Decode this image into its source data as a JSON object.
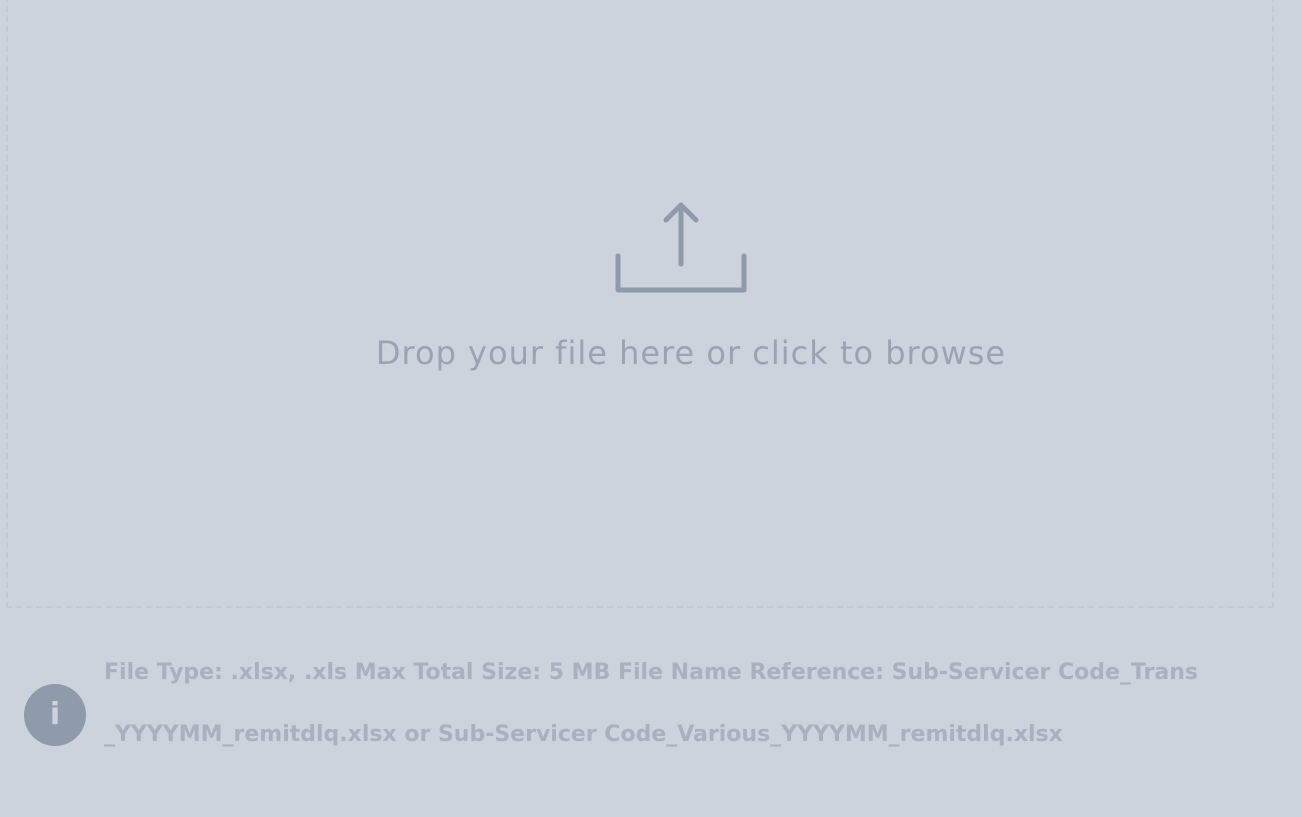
{
  "upload": {
    "icon": "upload-icon",
    "prompt": "Drop your file here or click to browse"
  },
  "info": {
    "icon": "info-icon",
    "icon_glyph": "i",
    "line1": "File Type: .xlsx, .xls Max Total Size: 5 MB File Name Reference: Sub-Servicer Code_Trans",
    "line2": "_YYYYMM_remitdlq.xlsx or Sub-Servicer Code_Various_YYYYMM_remitdlq.xlsx"
  },
  "colors": {
    "background": "#cdd3dc",
    "icon": "#8f9aab",
    "text": "#9aa3b1"
  }
}
